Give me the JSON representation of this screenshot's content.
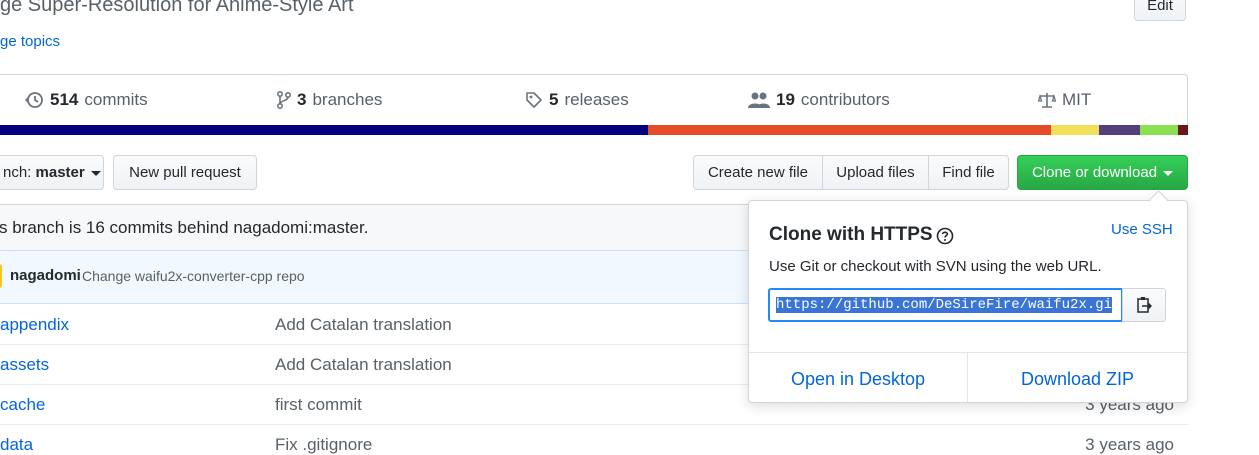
{
  "header": {
    "description": "ge Super-Resolution for Anime-Style Art",
    "topics_link": "ge topics",
    "edit_label": "Edit"
  },
  "summary": {
    "commits_count": "514",
    "commits_label": "commits",
    "branches_count": "3",
    "branches_label": "branches",
    "releases_count": "5",
    "releases_label": "releases",
    "contributors_count": "19",
    "contributors_label": "contributors",
    "license": "MIT"
  },
  "language_colors": [
    "#000080",
    "#e34c26",
    "#f1e05a",
    "#563d7c",
    "#89e051",
    "#701516"
  ],
  "toolbar": {
    "branch_prefix": "nch:",
    "branch_name": "master",
    "new_pr": "New pull request",
    "create_file": "Create new file",
    "upload_files": "Upload files",
    "find_file": "Find file",
    "clone_download": "Clone or download"
  },
  "branch_info": "s branch is 16 commits behind nagadomi:master.",
  "latest_commit": {
    "author": "nagadomi",
    "message": "Change waifu2x-converter-cpp repo"
  },
  "files": [
    {
      "name": "appendix",
      "message": "Add Catalan translation",
      "age": ""
    },
    {
      "name": "assets",
      "message": "Add Catalan translation",
      "age": ""
    },
    {
      "name": "cache",
      "message": "first commit",
      "age": "3 years ago"
    },
    {
      "name": "data",
      "message": "Fix .gitignore",
      "age": "3 years ago"
    }
  ],
  "clone_dropdown": {
    "title": "Clone with HTTPS",
    "use_ssh": "Use SSH",
    "hint": "Use Git or checkout with SVN using the web URL.",
    "url": "https://github.com/DeSireFire/waifu2x.gi",
    "open_desktop": "Open in Desktop",
    "download_zip": "Download ZIP"
  }
}
